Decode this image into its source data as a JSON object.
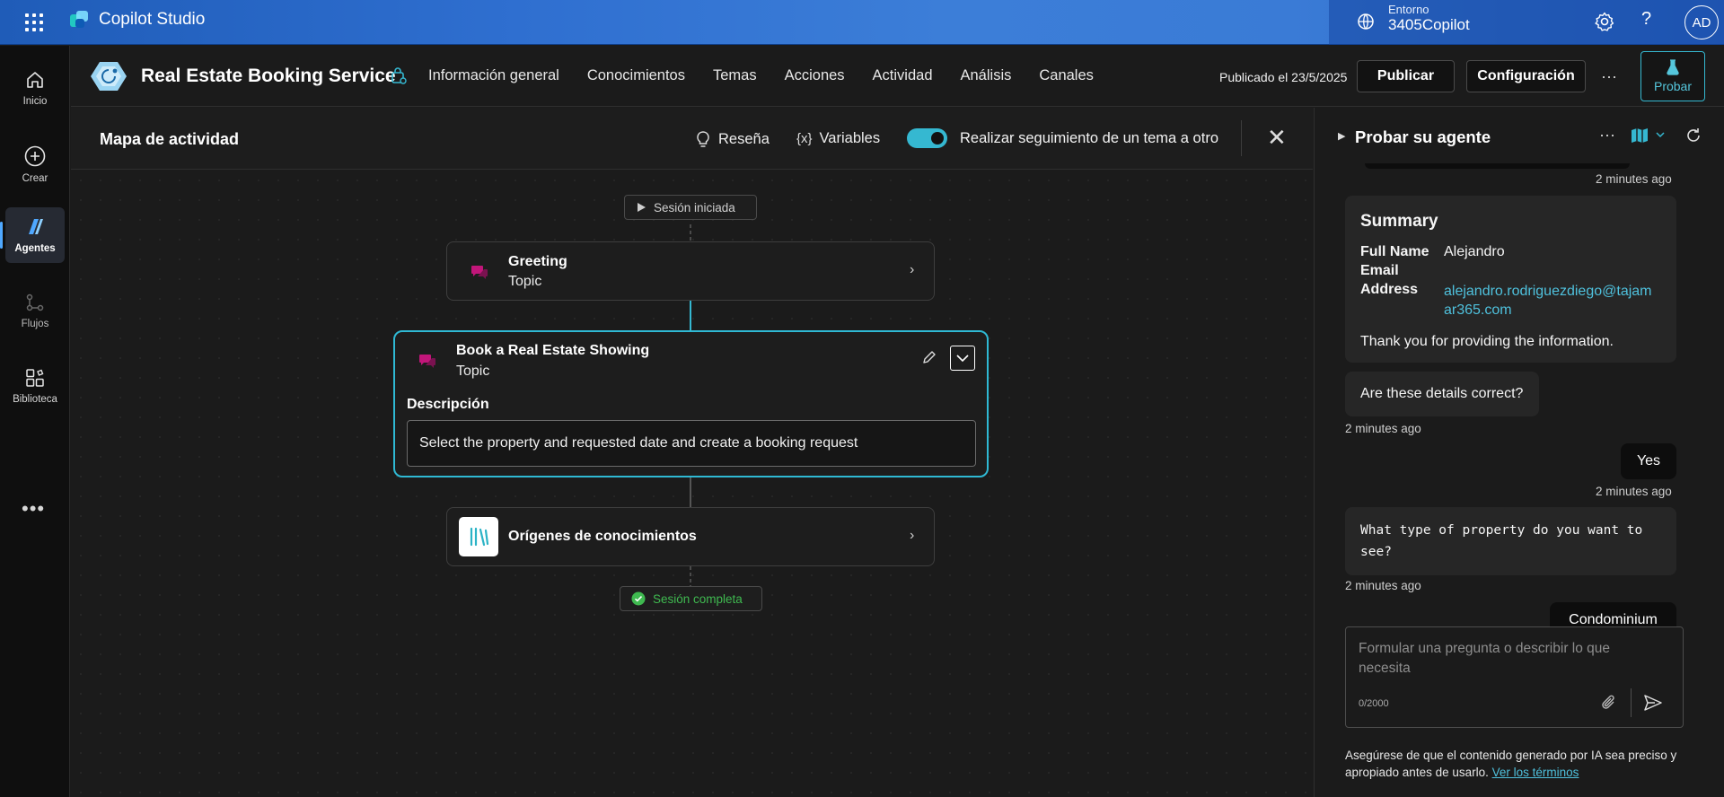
{
  "topbar": {
    "app_name": "Copilot Studio",
    "env_label": "Entorno",
    "env_value": "3405Copilot",
    "avatar_initials": "AD"
  },
  "rail": {
    "items": [
      {
        "label": "Inicio",
        "icon": "home-icon"
      },
      {
        "label": "Crear",
        "icon": "plus-circle-icon"
      },
      {
        "label": "Agentes",
        "icon": "agents-icon",
        "active": true
      },
      {
        "label": "Flujos",
        "icon": "flows-icon"
      },
      {
        "label": "Biblioteca",
        "icon": "library-icon"
      }
    ],
    "more": "•••"
  },
  "agent": {
    "name": "Real Estate Booking Service",
    "nav": [
      "Información general",
      "Conocimientos",
      "Temas",
      "Acciones",
      "Actividad",
      "Análisis",
      "Canales"
    ],
    "published": "Publicado el 23/5/2025",
    "publish_label": "Publicar",
    "config_label": "Configuración",
    "more": "···",
    "test_label": "Probar"
  },
  "canvas_header": {
    "title": "Mapa de actividad",
    "review_label": "Reseña",
    "variables_label": "Variables",
    "variables_glyph": "{x}",
    "track_label": "Realizar seguimiento de un tema a otro",
    "track_enabled": true
  },
  "flow": {
    "start_label": "Sesión iniciada",
    "greeting": {
      "title": "Greeting",
      "subtitle": "Topic"
    },
    "booking": {
      "title": "Book a Real Estate Showing",
      "subtitle": "Topic",
      "desc_label": "Descripción",
      "desc_value": "Select the property and requested date and create a booking request"
    },
    "knowledge": {
      "title": "Orígenes de conocimientos"
    },
    "end_label": "Sesión completa"
  },
  "panel": {
    "title": "Probar su agente",
    "more": "···",
    "messages": {
      "ts1": "2 minutes ago",
      "summary_title": "Summary",
      "full_name_key": "Full Name",
      "full_name_val": "Alejandro",
      "email_key": "Email",
      "address_key": "Address",
      "email_val_line1": "alejandro.rodriguezdiego@tajam",
      "email_val_line2": "ar365.com",
      "thanks": "Thank you for providing the information.",
      "confirm_q": "Are these details correct?",
      "ts2": "2 minutes ago",
      "yes": "Yes",
      "ts3": "2 minutes ago",
      "prop_q_line1": "What type of property do you want to",
      "prop_q_line2": "see?",
      "ts4": "2 minutes ago",
      "condo": "Condominium"
    },
    "composer": {
      "placeholder": "Formular una pregunta o describir lo que necesita",
      "counter": "0/2000"
    },
    "disclaimer": "Asegúrese de que el contenido generado por IA sea preciso y apropiado antes de usarlo.",
    "terms_link": "Ver los términos"
  },
  "colors": {
    "accent": "#35b8d1",
    "topbar": "#2f6fd0",
    "topic_icon": "#c2167a",
    "success": "#3fb950"
  }
}
